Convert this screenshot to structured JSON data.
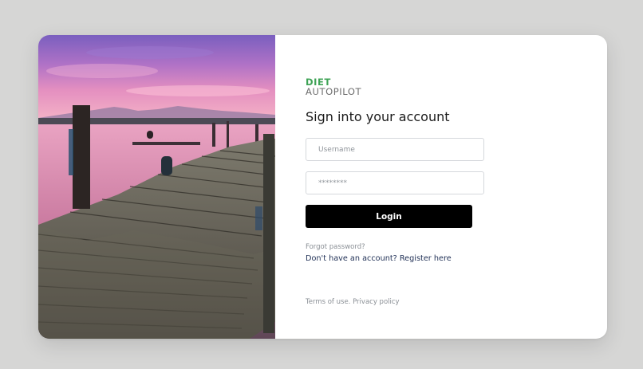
{
  "brand": {
    "line1": "DIET",
    "line2": "AUTOPILOT",
    "accent_color": "#3fa356"
  },
  "login_form": {
    "title": "Sign into your account",
    "username_placeholder": "Username",
    "password_placeholder": "********",
    "submit_label": "Login",
    "forgot_password": "Forgot password?",
    "register_prompt": "Don't have an account? Register here"
  },
  "footer": {
    "terms_label": "Terms of use.",
    "privacy_label": "Privacy policy"
  },
  "hero_image": {
    "icon": "wooden-pier-at-sunset-photo"
  }
}
